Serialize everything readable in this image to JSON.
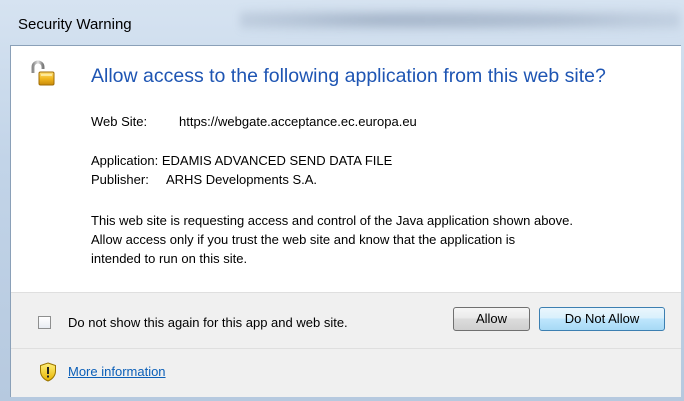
{
  "window": {
    "title": "Security Warning"
  },
  "dialog": {
    "icon": "padlock-icon",
    "headline": "Allow access to the following application from this web site?",
    "web_site": {
      "label": "Web Site:",
      "value": "https://webgate.acceptance.ec.europa.eu"
    },
    "application": {
      "label": "Application:",
      "value": "EDAMIS ADVANCED SEND DATA FILE"
    },
    "publisher": {
      "label": "Publisher:",
      "value": "ARHS Developments S.A."
    },
    "description": {
      "line1": "This web site is requesting access and control of the Java application shown above.",
      "line2": "Allow access only if you trust the web site and know that the application is",
      "line3": "intended to run on this site."
    }
  },
  "actions": {
    "checkbox_label": "Do not show this again for this app and web site.",
    "checkbox_checked": false,
    "allow_label": "Allow",
    "deny_label": "Do Not Allow"
  },
  "footer": {
    "icon": "shield-warning-icon",
    "link_label": "More information"
  },
  "colors": {
    "headline": "#1e55b3",
    "link": "#0b5fb8",
    "shield": "#f5d21c"
  }
}
